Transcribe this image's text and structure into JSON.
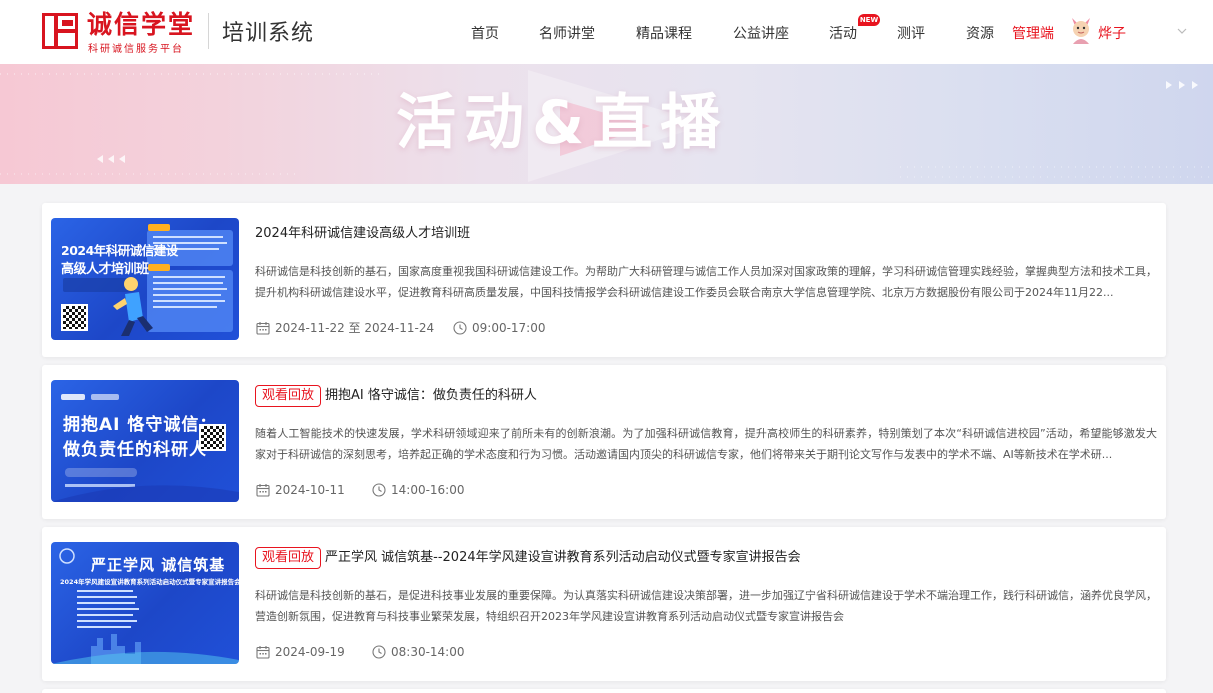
{
  "header": {
    "logo_name": "诚信学堂",
    "logo_sub": "科研诚信服务平台",
    "system_title": "培训系统",
    "nav": [
      "首页",
      "名师讲堂",
      "精品课程",
      "公益讲座",
      "活动",
      "测评",
      "资源"
    ],
    "new_badge": "NEW",
    "admin_label": "管理端",
    "user_name": "烨子"
  },
  "banner": {
    "title": "活动&直播"
  },
  "cards": [
    {
      "thumb_line1": "2024年科研诚信建设",
      "thumb_line2": "高级人才培训班",
      "tag": "",
      "title": "2024年科研诚信建设高级人才培训班",
      "desc": "科研诚信是科技创新的基石，国家高度重视我国科研诚信建设工作。为帮助广大科研管理与诚信工作人员加深对国家政策的理解，学习科研诚信管理实践经验，掌握典型方法和技术工具，提升机构科研诚信建设水平，促进教育科研高质量发展，中国科技情报学会科研诚信建设工作委员会联合南京大学信息管理学院、北京万方数据股份有限公司于2024年11月22...",
      "date": "2024-11-22 至 2024-11-24",
      "time": "09:00-17:00"
    },
    {
      "thumb_line1": "拥抱AI 恪守诚信：",
      "thumb_line2": "做负责任的科研人",
      "tag": "观看回放",
      "title": "拥抱AI 恪守诚信：做负责任的科研人",
      "desc": "随着人工智能技术的快速发展，学术科研领域迎来了前所未有的创新浪潮。为了加强科研诚信教育，提升高校师生的科研素养，特别策划了本次“科研诚信进校园”活动，希望能够激发大家对于科研诚信的深刻思考，培养起正确的学术态度和行为习惯。活动邀请国内顶尖的科研诚信专家，他们将带来关于期刊论文写作与发表中的学术不端、AI等新技术在学术研...",
      "date": "2024-10-11",
      "time": "14:00-16:00"
    },
    {
      "thumb_line1": "严正学风 诚信筑基",
      "thumb_line2": "2024年学风建设宣讲教育系列活动启动仪式暨专家宣讲报告会",
      "tag": "观看回放",
      "title": "严正学风 诚信筑基--2024年学风建设宣讲教育系列活动启动仪式暨专家宣讲报告会",
      "desc": "科研诚信是科技创新的基石，是促进科技事业发展的重要保障。为认真落实科研诚信建设决策部署，进一步加强辽宁省科研诚信建设于学术不端治理工作，践行科研诚信，涵养优良学风，营造创新氛围，促进教育与科技事业繁荣发展，特组织召开2023年学风建设宣讲教育系列活动启动仪式暨专家宣讲报告会",
      "date": "2024-09-19",
      "time": "08:30-14:00"
    }
  ],
  "colors": {
    "accent": "#e8141f",
    "brand": "#d8141f",
    "thumb_blue": "#2458dc"
  }
}
